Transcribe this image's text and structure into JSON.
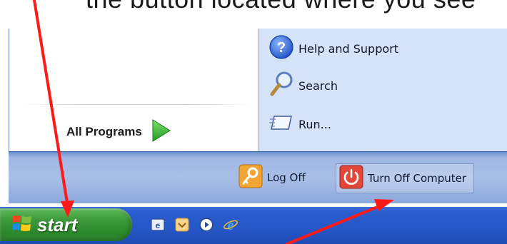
{
  "caption": {
    "text": "the button located where you see"
  },
  "start_menu": {
    "all_programs_label": "All Programs",
    "right_pane": {
      "items": [
        {
          "label": "Help and Support",
          "icon": "help-icon"
        },
        {
          "label": "Search",
          "icon": "search-icon"
        },
        {
          "label": "Run...",
          "icon": "run-icon"
        }
      ]
    },
    "bottom_bar": {
      "log_off_label": "Log Off",
      "turn_off_label": "Turn Off Computer"
    }
  },
  "taskbar": {
    "start_label": "start",
    "quick_launch": [
      "outlook-express-icon",
      "show-desktop-icon",
      "media-player-icon",
      "internet-explorer-icon"
    ]
  },
  "colors": {
    "annotation_arrow": "#ff1a1a",
    "start_button": "#3e9a3c",
    "taskbar": "#2657c7",
    "menu_right_pane": "#d4e3f7"
  }
}
